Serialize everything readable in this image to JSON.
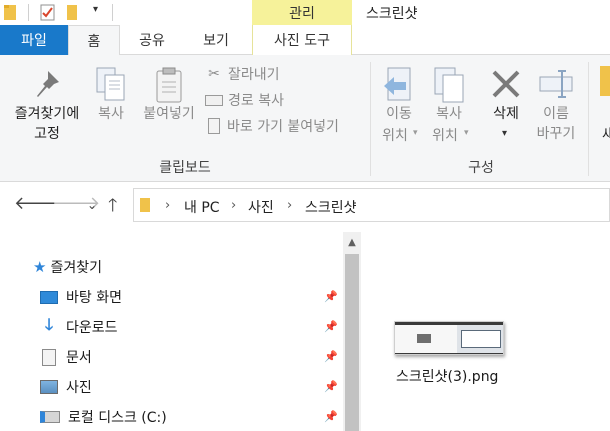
{
  "titlebar": {
    "window_title": "스크린샷",
    "manage_tab": "관리"
  },
  "tabs": {
    "file": "파일",
    "home": "홈",
    "share": "공유",
    "view": "보기",
    "photo_tools": "사진 도구"
  },
  "ribbon": {
    "pin_quick_access_line1": "즐겨찾기에",
    "pin_quick_access_line2": "고정",
    "copy": "복사",
    "paste": "붙여넣기",
    "cut": "잘라내기",
    "copy_path": "경로 복사",
    "paste_shortcut": "바로 가기 붙여넣기",
    "clipboard_group": "클립보드",
    "move_to_line1": "이동",
    "move_to_line2": "위치",
    "copy_to_line1": "복사",
    "copy_to_line2": "위치",
    "delete": "삭제",
    "rename_line1": "이름",
    "rename_line2": "바꾸기",
    "organize_group": "구성"
  },
  "address": {
    "crumbs": [
      "내 PC",
      "사진",
      "스크린샷"
    ]
  },
  "nav": {
    "quick_access": "즐겨찾기",
    "items": [
      "바탕 화면",
      "다운로드",
      "문서",
      "사진",
      "로컬 디스크 (C:)"
    ]
  },
  "files": [
    {
      "name": "스크린샷(3).png"
    }
  ],
  "colors": {
    "file_tab": "#1979ca",
    "manage_tab": "#f6f29a",
    "ribbon_bg": "#f5f6f7"
  }
}
